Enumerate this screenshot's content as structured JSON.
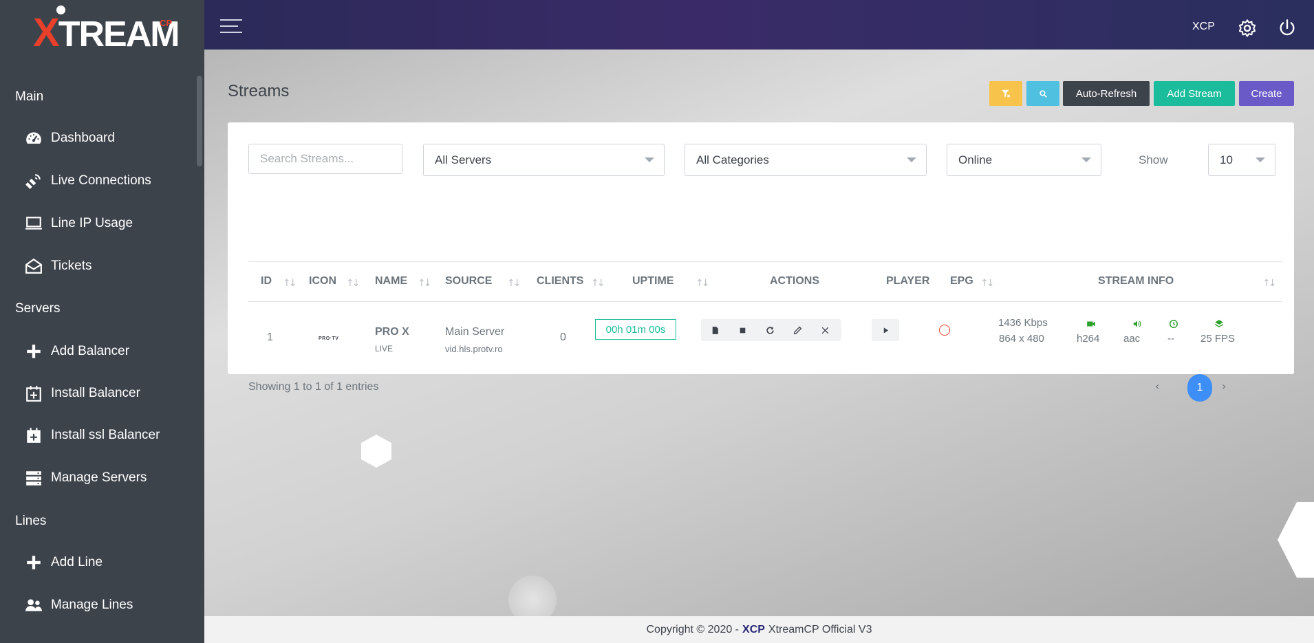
{
  "brand": {
    "logo_text": "XTREAM",
    "logo_sup": "CP"
  },
  "sidebar": {
    "sections": [
      {
        "label": "Main",
        "items": [
          {
            "label": "Dashboard",
            "icon": "dashboard-icon"
          },
          {
            "label": "Live Connections",
            "icon": "satellite-icon"
          },
          {
            "label": "Line IP Usage",
            "icon": "laptop-icon"
          },
          {
            "label": "Tickets",
            "icon": "envelope-open-icon"
          }
        ]
      },
      {
        "label": "Servers",
        "items": [
          {
            "label": "Add Balancer",
            "icon": "plus-icon"
          },
          {
            "label": "Install Balancer",
            "icon": "calendar-plus-icon"
          },
          {
            "label": "Install ssl Balancer",
            "icon": "calendar-plus-icon"
          },
          {
            "label": "Manage Servers",
            "icon": "server-icon"
          }
        ]
      },
      {
        "label": "Lines",
        "items": [
          {
            "label": "Add Line",
            "icon": "plus-icon"
          },
          {
            "label": "Manage Lines",
            "icon": "users-icon"
          }
        ]
      }
    ]
  },
  "topbar": {
    "user": "XCP"
  },
  "page": {
    "title": "Streams",
    "buttons": {
      "auto_refresh": "Auto-Refresh",
      "add_stream": "Add Stream",
      "create": "Create"
    },
    "colors": {
      "filter": "#f8c34a",
      "search": "#4fc0e0",
      "auto_refresh": "#3d434b",
      "add_stream": "#1abc9c",
      "create": "#6a5ac8"
    }
  },
  "filters": {
    "search_placeholder": "Search Streams...",
    "server": "All Servers",
    "category": "All Categories",
    "status": "Online",
    "show_label": "Show",
    "show_value": "10"
  },
  "table": {
    "columns": [
      "ID",
      "ICON",
      "NAME",
      "SOURCE",
      "CLIENTS",
      "UPTIME",
      "ACTIONS",
      "PLAYER",
      "EPG",
      "STREAM INFO"
    ],
    "rows": [
      {
        "id": "1",
        "icon_text": "PRO·TV",
        "name": "PRO X",
        "sub": "LIVE",
        "source": "Main Server",
        "source_url": "vid.hls.protv.ro",
        "clients": "0",
        "uptime": "00h 01m 00s",
        "bitrate": "1436 Kbps",
        "resolution": "864 x 480",
        "video_codec": "h264",
        "audio_codec": "aac",
        "latency": "--",
        "fps": "25 FPS"
      }
    ]
  },
  "pagination": {
    "summary": "Showing 1 to 1 of 1 entries",
    "current": "1",
    "prev": "‹",
    "next": "›"
  },
  "footer": {
    "prefix": "Copyright © 2020 -",
    "brand": "XCP",
    "suffix": "XtreamCP Official V3"
  }
}
